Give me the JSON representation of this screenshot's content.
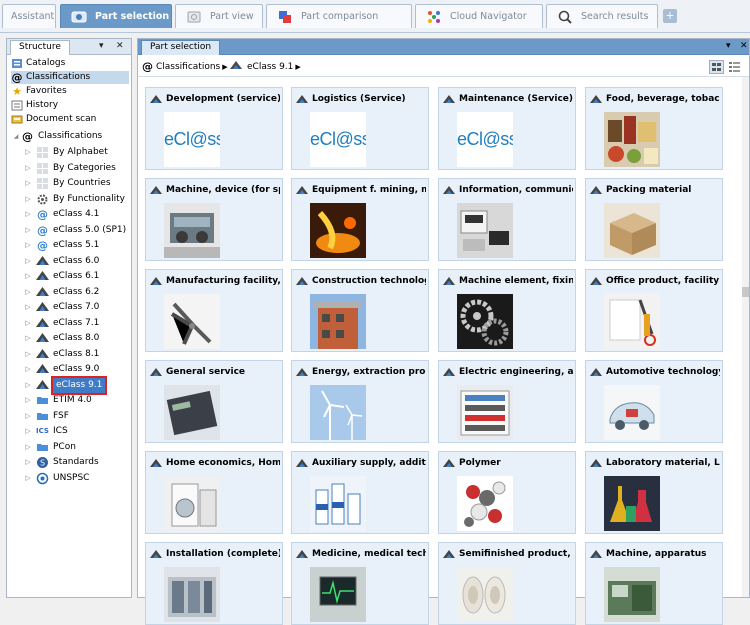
{
  "tabs": [
    {
      "label": "Assistant",
      "icon": "assistant-icon"
    },
    {
      "label": "Part selection",
      "icon": "part-selection-icon",
      "active": true
    },
    {
      "label": "Part view",
      "icon": "part-view-icon"
    },
    {
      "label": "Part comparison",
      "icon": "part-comparison-icon"
    },
    {
      "label": "Cloud Navigator",
      "icon": "cloud-navigator-icon"
    },
    {
      "label": "Search results",
      "icon": "search-icon"
    }
  ],
  "add_tab_label": "+",
  "structure": {
    "title": "Structure",
    "nav": [
      {
        "label": "Catalogs",
        "icon": "catalogs-icon"
      },
      {
        "label": "Classifications",
        "icon": "classifications-icon",
        "selected": true
      },
      {
        "label": "Favorites",
        "icon": "star-icon"
      },
      {
        "label": "History",
        "icon": "history-icon"
      },
      {
        "label": "Document scan",
        "icon": "document-scan-icon"
      }
    ],
    "tree_root": "Classifications",
    "tree": [
      {
        "label": "By Alphabet",
        "icon": "grid-icon"
      },
      {
        "label": "By Categories",
        "icon": "grid-icon"
      },
      {
        "label": "By Countries",
        "icon": "grid-icon"
      },
      {
        "label": "By Functionality",
        "icon": "gear-icon"
      },
      {
        "label": "eClass 4.1",
        "icon": "at-icon"
      },
      {
        "label": "eClass 5.0 (SP1)",
        "icon": "at-icon"
      },
      {
        "label": "eClass 5.1",
        "icon": "at-icon"
      },
      {
        "label": "eClass 6.0",
        "icon": "eclass-icon"
      },
      {
        "label": "eClass 6.1",
        "icon": "eclass-icon"
      },
      {
        "label": "eClass 6.2",
        "icon": "eclass-icon"
      },
      {
        "label": "eClass 7.0",
        "icon": "eclass-icon"
      },
      {
        "label": "eClass 7.1",
        "icon": "eclass-icon"
      },
      {
        "label": "eClass 8.0",
        "icon": "eclass-icon"
      },
      {
        "label": "eClass 8.1",
        "icon": "eclass-icon"
      },
      {
        "label": "eClass 9.0",
        "icon": "eclass-icon"
      },
      {
        "label": "eClass 9.1",
        "icon": "eclass-icon",
        "highlighted": true
      },
      {
        "label": "ETIM 4.0",
        "icon": "folder-icon"
      },
      {
        "label": "FSF",
        "icon": "folder-icon"
      },
      {
        "label": "ICS",
        "icon": "ics-icon"
      },
      {
        "label": "PCon",
        "icon": "folder-icon"
      },
      {
        "label": "Standards",
        "icon": "standards-icon"
      },
      {
        "label": "UNSPSC",
        "icon": "unspsc-icon"
      }
    ]
  },
  "main": {
    "title": "Part selection",
    "breadcrumb": [
      "Classifications",
      "eClass 9.1"
    ],
    "cards": [
      {
        "title": "Development (service)",
        "image": "eclass-logo",
        "logo_text": "eCl@ss"
      },
      {
        "title": "Logistics (Service)",
        "image": "eclass-logo",
        "logo_text": "eCl@ss"
      },
      {
        "title": "Maintenance (Service)",
        "image": "eclass-logo",
        "logo_text": "eCl@ss"
      },
      {
        "title": "Food, beverage, tobacco",
        "image": "food-photo"
      },
      {
        "title": "Machine, device (for special",
        "image": "machine-photo"
      },
      {
        "title": "Equipment f. mining, metal",
        "image": "molten-metal-photo"
      },
      {
        "title": "Information, communication",
        "image": "office-devices-photo"
      },
      {
        "title": "Packing material",
        "image": "cardboard-box-photo"
      },
      {
        "title": "Manufacturing facility, wor",
        "image": "pliers-photo"
      },
      {
        "title": "Construction technology",
        "image": "building-photo"
      },
      {
        "title": "Machine element, fixing, m",
        "image": "gears-photo"
      },
      {
        "title": "Office product, facility and",
        "image": "scissors-photo"
      },
      {
        "title": "General service",
        "image": "calculator-photo"
      },
      {
        "title": "Energy, extraction product",
        "image": "wind-turbines-photo"
      },
      {
        "title": "Electric engineering, auton",
        "image": "electrical-cabinet-photo"
      },
      {
        "title": "Automotive technology",
        "image": "car-xray-photo"
      },
      {
        "title": "Home economics, Home te",
        "image": "washing-machine-photo"
      },
      {
        "title": "Auxiliary supply, additive, c",
        "image": "bottles-photo"
      },
      {
        "title": "Polymer",
        "image": "molecule-photo"
      },
      {
        "title": "Laboratory material, Labora",
        "image": "lab-flasks-photo"
      },
      {
        "title": "Installation (complete)",
        "image": "installation-photo"
      },
      {
        "title": "Medicine, medical technol",
        "image": "medical-monitor-photo"
      },
      {
        "title": "Semifinished product, mat",
        "image": "pipes-photo"
      },
      {
        "title": "Machine, apparatus",
        "image": "apparatus-photo"
      }
    ]
  },
  "colors": {
    "accent": "#6b9ac9",
    "card_bg": "#e8f1fa",
    "selection": "#3e7cc8",
    "highlight_border": "#e02020",
    "eclass_blue": "#1f7fc0"
  }
}
